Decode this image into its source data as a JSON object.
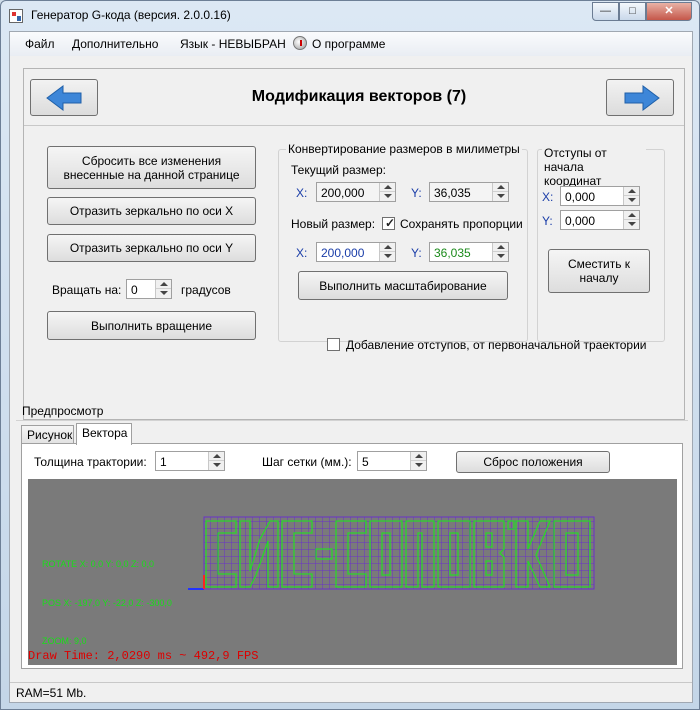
{
  "window": {
    "title": "Генератор G-кода (версия. 2.0.0.16)",
    "controls": {
      "minimize": "—",
      "maximize": "□",
      "close": "✕"
    }
  },
  "menu": {
    "file": "Файл",
    "extra": "Дополнительно",
    "language": "Язык - НЕВЫБРАН",
    "about": "О программе"
  },
  "page": {
    "title": "Модификация векторов (7)",
    "nav_back_icon": "arrow-left-icon",
    "nav_next_icon": "arrow-right-icon",
    "accent_color": "#3d86d8"
  },
  "left_panel": {
    "reset_button": "Сбросить все изменения внесенные на данной странице",
    "mirror_x_button": "Отразить зеркально по оси X",
    "mirror_y_button": "Отразить зеркально по оси Y",
    "rotate_label": "Вращать на:",
    "rotate_value": "0",
    "rotate_unit": "градусов",
    "rotate_button": "Выполнить вращение"
  },
  "size_group": {
    "title": "Конвертирование размеров в милиметры",
    "current_label": "Текущий размер:",
    "current_x_label": "X:",
    "current_x": "200,000",
    "current_y_label": "Y:",
    "current_y": "36,035",
    "new_label": "Новый размер:",
    "keep_ratio_label": "Сохранять пропорции",
    "keep_ratio_checked": true,
    "new_x_label": "X:",
    "new_x": "200,000",
    "new_y_label": "Y:",
    "new_y": "36,035",
    "scale_button": "Выполнить масштабирование"
  },
  "offset_group": {
    "title": "Отступы от начала координат",
    "x_label": "X:",
    "x_value": "0,000",
    "y_label": "Y:",
    "y_value": "0,000",
    "shift_button": "Сместить к началу"
  },
  "add_offsets": {
    "label": "Добавление отступов, от первоначальной траектории",
    "checked": false
  },
  "preview": {
    "title": "Предпросмотр",
    "tabs": [
      "Рисунок",
      "Вектора"
    ],
    "active_tab": "Вектора",
    "thickness_label": "Толщина трактории:",
    "thickness_value": "1",
    "grid_label": "Шаг сетки (мм.):",
    "grid_value": "5",
    "reset_button": "Сброс положения",
    "rotate_text": "ROTATE X: 0,0  Y: 0,0 Z: 0,0",
    "pos_text": "POS X: -197,0  Y: -22,0 Z: -300,0",
    "zoom_text": "ZOOM: 9,0",
    "fps_text": "Draw Time: 2,0290 ms ~ 492,9 FPS",
    "grid_color": "#6a32c8",
    "path_color": "#2ad62a",
    "bg_color": "#7a7a7a"
  },
  "status": {
    "ram": "RAM=51 Mb."
  }
}
